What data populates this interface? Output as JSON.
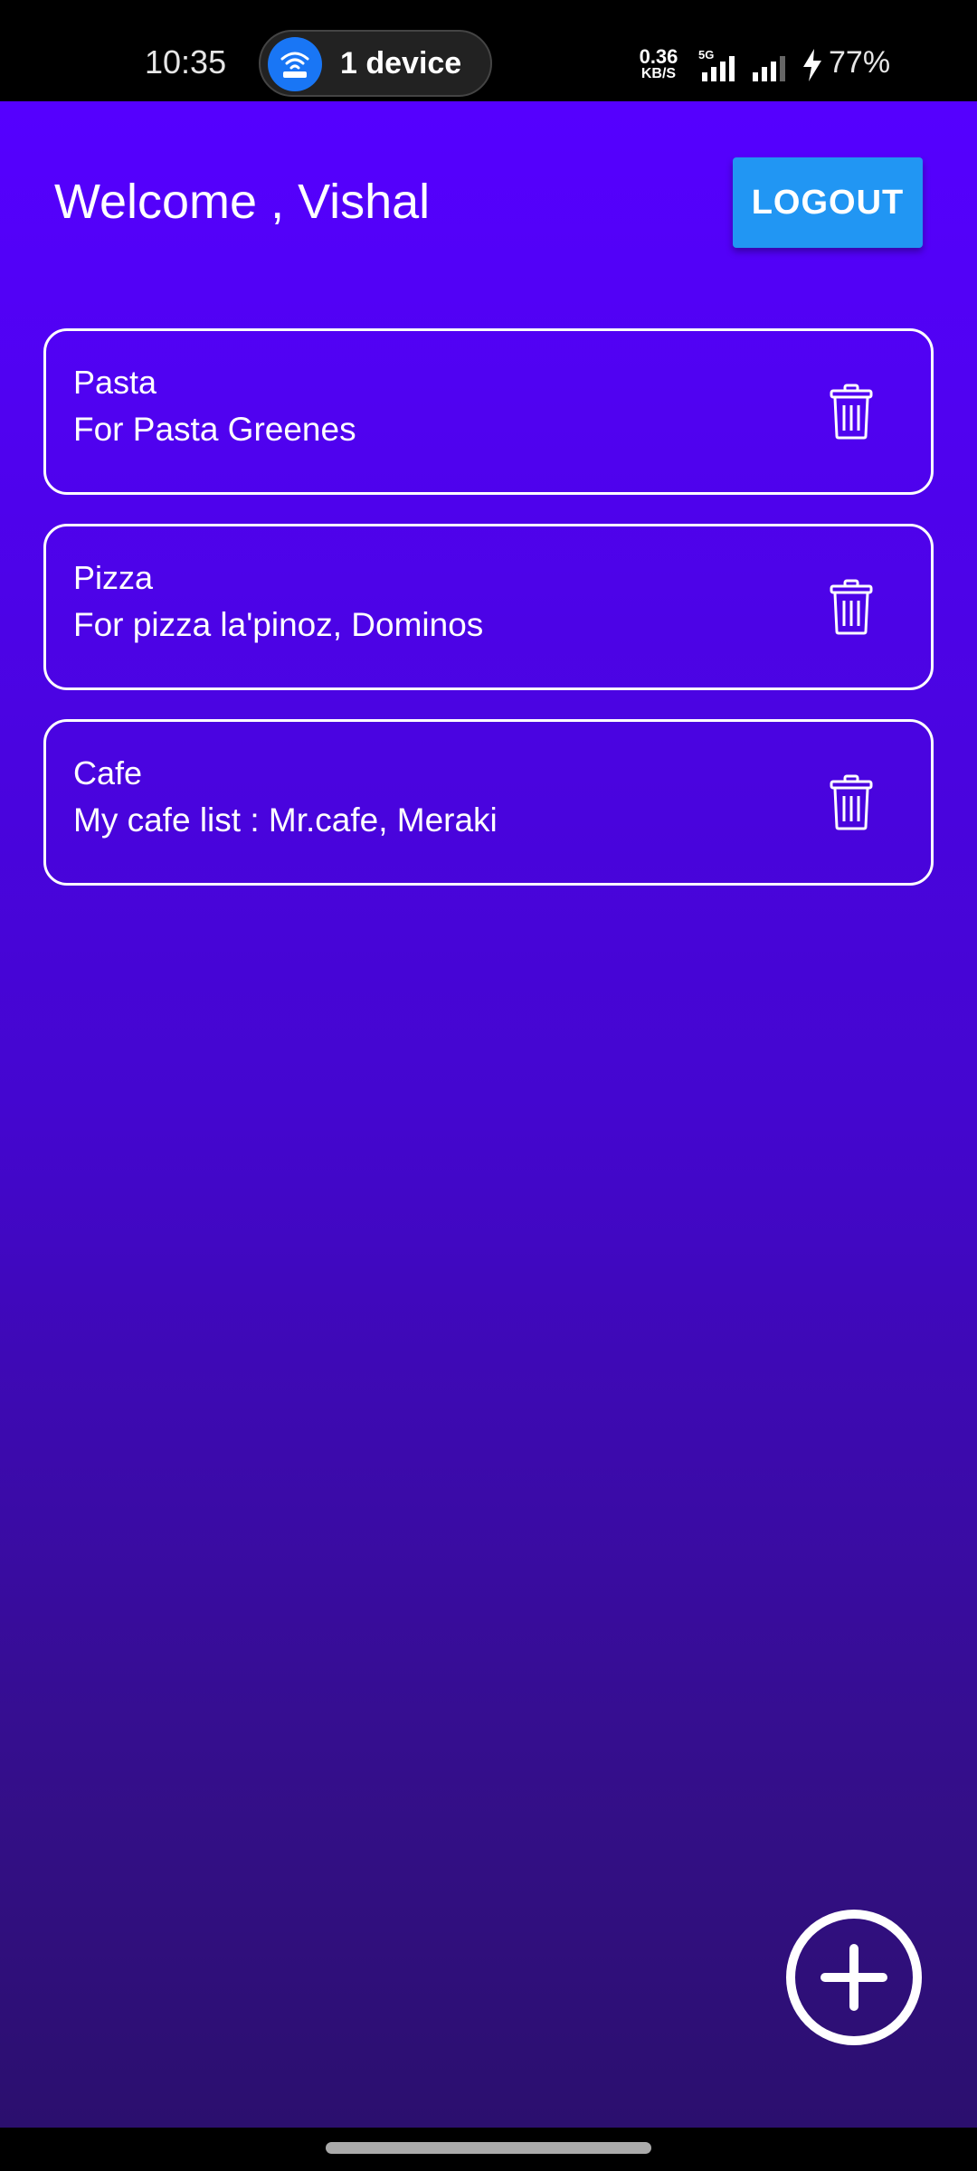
{
  "status_bar": {
    "time": "10:35",
    "hotspot_text": "1 device",
    "net_speed_value": "0.36",
    "net_speed_unit": "KB/S",
    "network_type": "5G",
    "battery": "77%"
  },
  "header": {
    "welcome": "Welcome , Vishal",
    "logout_label": "LOGOUT"
  },
  "notes": [
    {
      "title": "Pasta",
      "description": "For Pasta Greenes"
    },
    {
      "title": "Pizza",
      "description": "For pizza la'pinoz, Dominos"
    },
    {
      "title": "Cafe",
      "description": "My cafe list : Mr.cafe, Meraki"
    }
  ],
  "icons": {
    "delete": "trash-icon",
    "add": "plus-circle-icon",
    "hotspot": "wifi-hotspot-icon",
    "charging": "bolt-icon"
  },
  "colors": {
    "gradient_top": "#5500ff",
    "gradient_bottom": "#2b0f6e",
    "logout_button": "#2196f3",
    "hotspot_circle": "#1976f5"
  }
}
